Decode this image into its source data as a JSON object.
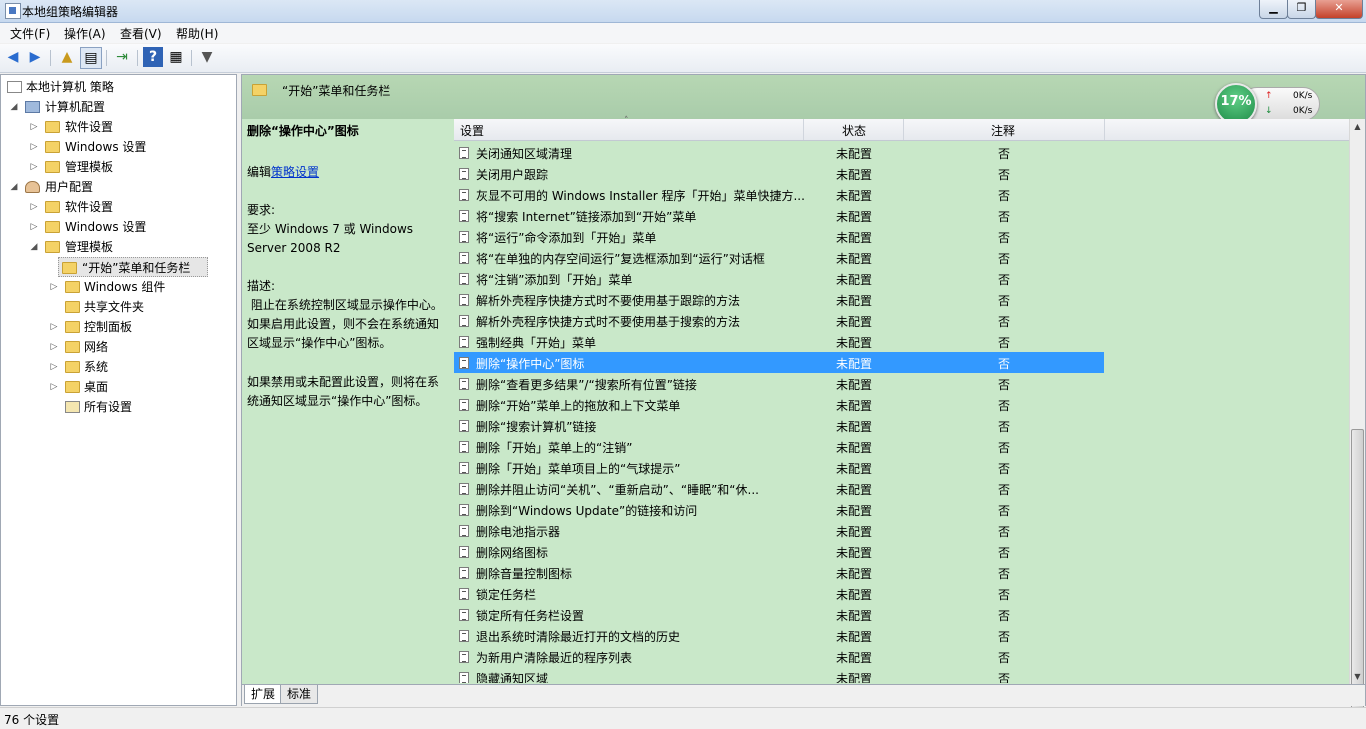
{
  "window": {
    "title": "本地组策略编辑器"
  },
  "menu": [
    "文件(F)",
    "操作(A)",
    "查看(V)",
    "帮助(H)"
  ],
  "tree": {
    "root": "本地计算机 策略",
    "computer_config": "计算机配置",
    "software": "软件设置",
    "windows_settings": "Windows 设置",
    "admin_templates": "管理模板",
    "user_config": "用户配置",
    "user_software": "软件设置",
    "user_windows_settings": "Windows 设置",
    "user_admin_templates": "管理模板",
    "start_menu": "“开始”菜单和任务栏",
    "windows_components": "Windows 组件",
    "shared_folders": "共享文件夹",
    "control_panel": "控制面板",
    "network": "网络",
    "system": "系统",
    "desktop": "桌面",
    "all_settings": "所有设置"
  },
  "header": {
    "title": "“开始”菜单和任务栏"
  },
  "description": {
    "policy_name": "删除“操作中心”图标",
    "edit_prefix": "编辑",
    "edit_link": "策略设置",
    "req_label": "要求:",
    "req_line1": "至少 Windows 7 或 Windows",
    "req_line2": "Server 2008 R2",
    "desc_label": "描述:",
    "desc_line1": " 阻止在系统控制区域显示操作中心。",
    "desc_line2": "如果启用此设置，则不会在系统通知",
    "desc_line3": "区域显示“操作中心”图标。",
    "desc_line4": "如果禁用或未配置此设置，则将在系",
    "desc_line5": "统通知区域显示“操作中心”图标。"
  },
  "columns": {
    "setting": "设置",
    "state": "状态",
    "comment": "注释"
  },
  "rows": [
    {
      "name": "关闭通知区域清理",
      "state": "未配置",
      "comment": "否"
    },
    {
      "name": "关闭用户跟踪",
      "state": "未配置",
      "comment": "否"
    },
    {
      "name": "灰显不可用的 Windows Installer 程序「开始」菜单快捷方...",
      "state": "未配置",
      "comment": "否"
    },
    {
      "name": "将“搜索 Internet”链接添加到“开始”菜单",
      "state": "未配置",
      "comment": "否"
    },
    {
      "name": "将“运行”命令添加到「开始」菜单",
      "state": "未配置",
      "comment": "否"
    },
    {
      "name": "将“在单独的内存空间运行”复选框添加到“运行”对话框",
      "state": "未配置",
      "comment": "否"
    },
    {
      "name": "将“注销”添加到「开始」菜单",
      "state": "未配置",
      "comment": "否"
    },
    {
      "name": "解析外壳程序快捷方式时不要使用基于跟踪的方法",
      "state": "未配置",
      "comment": "否"
    },
    {
      "name": "解析外壳程序快捷方式时不要使用基于搜索的方法",
      "state": "未配置",
      "comment": "否"
    },
    {
      "name": "强制经典「开始」菜单",
      "state": "未配置",
      "comment": "否"
    },
    {
      "name": "删除“操作中心”图标",
      "state": "未配置",
      "comment": "否"
    },
    {
      "name": "删除“查看更多结果”/“搜索所有位置”链接",
      "state": "未配置",
      "comment": "否"
    },
    {
      "name": "删除“开始”菜单上的拖放和上下文菜单",
      "state": "未配置",
      "comment": "否"
    },
    {
      "name": "删除“搜索计算机”链接",
      "state": "未配置",
      "comment": "否"
    },
    {
      "name": "删除「开始」菜单上的“注销”",
      "state": "未配置",
      "comment": "否"
    },
    {
      "name": "删除「开始」菜单项目上的“气球提示”",
      "state": "未配置",
      "comment": "否"
    },
    {
      "name": "删除并阻止访问“关机”、“重新启动”、“睡眠”和“休...",
      "state": "未配置",
      "comment": "否"
    },
    {
      "name": "删除到“Windows Update”的链接和访问",
      "state": "未配置",
      "comment": "否"
    },
    {
      "name": "删除电池指示器",
      "state": "未配置",
      "comment": "否"
    },
    {
      "name": "删除网络图标",
      "state": "未配置",
      "comment": "否"
    },
    {
      "name": "删除音量控制图标",
      "state": "未配置",
      "comment": "否"
    },
    {
      "name": "锁定任务栏",
      "state": "未配置",
      "comment": "否"
    },
    {
      "name": "锁定所有任务栏设置",
      "state": "未配置",
      "comment": "否"
    },
    {
      "name": "退出系统时清除最近打开的文档的历史",
      "state": "未配置",
      "comment": "否"
    },
    {
      "name": "为新用户清除最近的程序列表",
      "state": "未配置",
      "comment": "否"
    },
    {
      "name": "隐藏通知区域",
      "state": "未配置",
      "comment": "否"
    }
  ],
  "tabs": [
    "扩展",
    "标准"
  ],
  "status": {
    "count": "76 个设置"
  },
  "net_widget": {
    "percent": "17%",
    "up": "0K/s",
    "down": "0K/s"
  }
}
